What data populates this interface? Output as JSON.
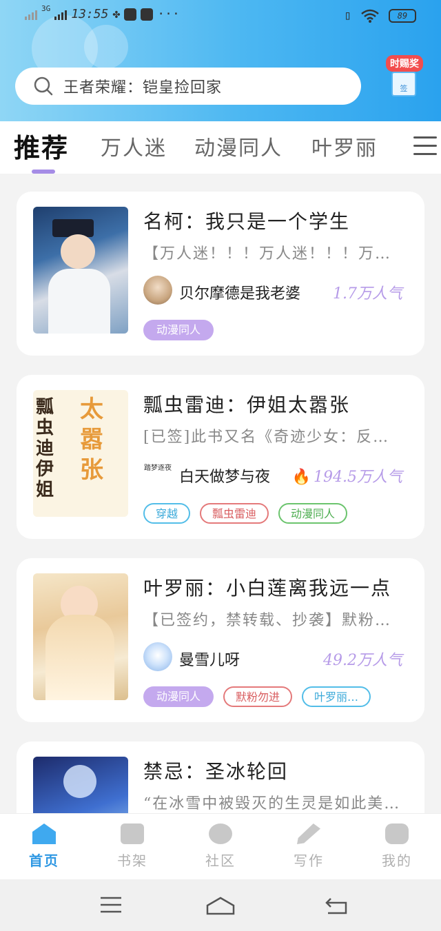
{
  "status_bar": {
    "network": "3G",
    "time": "13:55",
    "more": "···",
    "battery": "89"
  },
  "search": {
    "placeholder": "王者荣耀：铠皇捡回家"
  },
  "promo": {
    "label": "时赐奖",
    "box_label": "签"
  },
  "tabs": [
    {
      "label": "推荐",
      "active": true
    },
    {
      "label": "万人迷",
      "active": false
    },
    {
      "label": "动漫同人",
      "active": false
    },
    {
      "label": "叶罗丽",
      "active": false
    }
  ],
  "books": [
    {
      "title": "名柯：我只是一个学生",
      "desc": "【万人迷！！！万人迷！！！万人迷！！！】",
      "author": "贝尔摩德是我老婆",
      "popularity": "1.7万人气",
      "hot": false,
      "tags": [
        {
          "label": "动漫同人",
          "style": "fill"
        }
      ]
    },
    {
      "title": "瓢虫雷迪：伊姐太嚣张",
      "desc": "[已签]此书又名《奇迹少女：反派自救指南》",
      "author": "白天做梦与夜",
      "author_avatar_text": "踏梦逐夜",
      "popularity": "194.5万人气",
      "hot": true,
      "tags": [
        {
          "label": "穿越",
          "style": "blue"
        },
        {
          "label": "瓢虫雷迪",
          "style": "red"
        },
        {
          "label": "动漫同人",
          "style": "green"
        }
      ]
    },
    {
      "title": "叶罗丽：小白莲离我远一点",
      "desc": "【已签约，禁转载、抄袭】默粉勿进",
      "author": "曼雪儿呀",
      "popularity": "49.2万人气",
      "hot": false,
      "tags": [
        {
          "label": "动漫同人",
          "style": "fill"
        },
        {
          "label": "默粉勿进",
          "style": "red"
        },
        {
          "label": "叶罗丽…",
          "style": "blue"
        }
      ]
    },
    {
      "title": "禁忌：圣冰轮回",
      "desc": "“在冰雪中被毁灭的生灵是如此美丽”"
    }
  ],
  "bottom_nav": [
    {
      "label": "首页",
      "icon": "home-icon",
      "active": true
    },
    {
      "label": "书架",
      "icon": "bookshelf-icon",
      "active": false
    },
    {
      "label": "社区",
      "icon": "community-icon",
      "active": false
    },
    {
      "label": "写作",
      "icon": "pen-icon",
      "active": false
    },
    {
      "label": "我的",
      "icon": "profile-icon",
      "active": false
    }
  ],
  "colors": {
    "accent_purple": "#c4a9ee",
    "header_blue": "#2aa2ee",
    "nav_active": "#2f98e3"
  }
}
